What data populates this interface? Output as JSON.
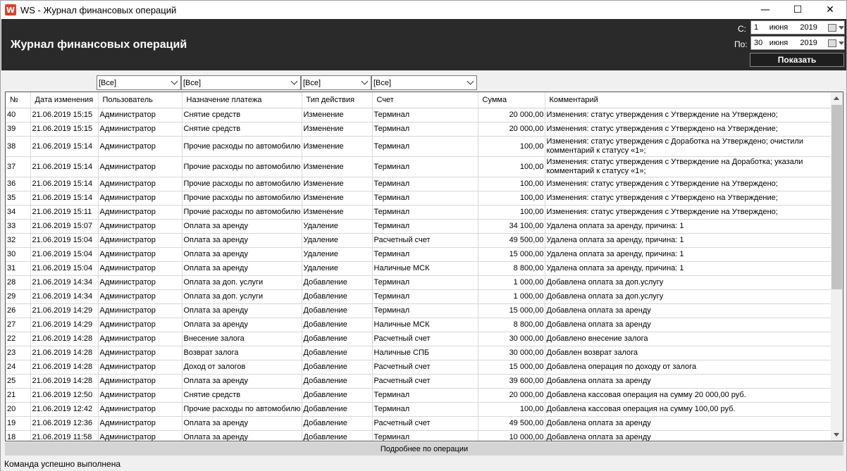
{
  "window": {
    "title": "WS - Журнал финансовых операций",
    "app_icon_letter": "W",
    "minimize": "—",
    "maximize": "☐",
    "close": "✕"
  },
  "header": {
    "title": "Журнал финансовых операций",
    "from_label": "С:",
    "to_label": "По:",
    "from_date": {
      "day": "1",
      "month": "июня",
      "year": "2019"
    },
    "to_date": {
      "day": "30",
      "month": "июня",
      "year": "2019"
    },
    "show_button": "Показать"
  },
  "filters": {
    "user": "[Все]",
    "purpose": "[Все]",
    "action": "[Все]",
    "account": "[Все]"
  },
  "table": {
    "columns": [
      "№",
      "Дата изменения",
      "Пользователь",
      "Назначение платежа",
      "Тип действия",
      "Счет",
      "Сумма",
      "Комментарий"
    ],
    "rows": [
      [
        "40",
        "21.06.2019 15:15",
        "Администратор",
        "Снятие средств",
        "Изменение",
        "Терминал",
        "20 000,00",
        "Изменения: статус утверждения с Утверждение на Утверждено;"
      ],
      [
        "39",
        "21.06.2019 15:15",
        "Администратор",
        "Снятие средств",
        "Изменение",
        "Терминал",
        "20 000,00",
        "Изменения: статус утверждения с Утверждено на Утверждение;"
      ],
      [
        "38",
        "21.06.2019 15:14",
        "Администратор",
        "Прочие расходы по автомобилю",
        "Изменение",
        "Терминал",
        "100,00",
        "Изменения: статус утверждения с Доработка на Утверждено; очистили комментарий к статусу «1»;"
      ],
      [
        "37",
        "21.06.2019 15:14",
        "Администратор",
        "Прочие расходы по автомобилю",
        "Изменение",
        "Терминал",
        "100,00",
        "Изменения: статус утверждения с Утверждение на Доработка; указали комментарий к статусу «1»;"
      ],
      [
        "36",
        "21.06.2019 15:14",
        "Администратор",
        "Прочие расходы по автомобилю",
        "Изменение",
        "Терминал",
        "100,00",
        "Изменения: статус утверждения с Утверждение на Утверждено;"
      ],
      [
        "35",
        "21.06.2019 15:14",
        "Администратор",
        "Прочие расходы по автомобилю",
        "Изменение",
        "Терминал",
        "100,00",
        "Изменения: статус утверждения с Утверждено на Утверждение;"
      ],
      [
        "34",
        "21.06.2019 15:11",
        "Администратор",
        "Прочие расходы по автомобилю",
        "Изменение",
        "Терминал",
        "100,00",
        "Изменения: статус утверждения с Утверждение на Утверждено;"
      ],
      [
        "33",
        "21.06.2019 15:07",
        "Администратор",
        "Оплата за аренду",
        "Удаление",
        "Терминал",
        "34 100,00",
        "Удалена оплата за аренду, причина: 1"
      ],
      [
        "32",
        "21.06.2019 15:04",
        "Администратор",
        "Оплата за аренду",
        "Удаление",
        "Расчетный счет",
        "49 500,00",
        "Удалена оплата за аренду, причина: 1"
      ],
      [
        "30",
        "21.06.2019 15:04",
        "Администратор",
        "Оплата за аренду",
        "Удаление",
        "Терминал",
        "15 000,00",
        "Удалена оплата за аренду, причина: 1"
      ],
      [
        "31",
        "21.06.2019 15:04",
        "Администратор",
        "Оплата за аренду",
        "Удаление",
        "Наличные МСК",
        "8 800,00",
        "Удалена оплата за аренду, причина: 1"
      ],
      [
        "28",
        "21.06.2019 14:34",
        "Администратор",
        "Оплата за доп. услуги",
        "Добавление",
        "Терминал",
        "1 000,00",
        "Добавлена оплата за доп.услугу"
      ],
      [
        "29",
        "21.06.2019 14:34",
        "Администратор",
        "Оплата за доп. услуги",
        "Добавление",
        "Терминал",
        "1 000,00",
        "Добавлена оплата за доп.услугу"
      ],
      [
        "26",
        "21.06.2019 14:29",
        "Администратор",
        "Оплата за аренду",
        "Добавление",
        "Терминал",
        "15 000,00",
        "Добавлена оплата за аренду"
      ],
      [
        "27",
        "21.06.2019 14:29",
        "Администратор",
        "Оплата за аренду",
        "Добавление",
        "Наличные МСК",
        "8 800,00",
        "Добавлена оплата за аренду"
      ],
      [
        "22",
        "21.06.2019 14:28",
        "Администратор",
        "Внесение залога",
        "Добавление",
        "Расчетный счет",
        "30 000,00",
        "Добавлено внесение залога"
      ],
      [
        "23",
        "21.06.2019 14:28",
        "Администратор",
        "Возврат залога",
        "Добавление",
        "Наличные СПБ",
        "30 000,00",
        "Добавлен возврат залога"
      ],
      [
        "24",
        "21.06.2019 14:28",
        "Администратор",
        "Доход от залогов",
        "Добавление",
        "Расчетный счет",
        "15 000,00",
        "Добавлена операция по доходу от залога"
      ],
      [
        "25",
        "21.06.2019 14:28",
        "Администратор",
        "Оплата за аренду",
        "Добавление",
        "Расчетный счет",
        "39 600,00",
        "Добавлена оплата за аренду"
      ],
      [
        "21",
        "21.06.2019 12:50",
        "Администратор",
        "Снятие средств",
        "Добавление",
        "Терминал",
        "20 000,00",
        "Добавлена кассовая операция на сумму 20 000,00 руб."
      ],
      [
        "20",
        "21.06.2019 12:42",
        "Администратор",
        "Прочие расходы по автомобилю",
        "Добавление",
        "Терминал",
        "100,00",
        "Добавлена кассовая операция на сумму 100,00 руб."
      ],
      [
        "19",
        "21.06.2019 12:36",
        "Администратор",
        "Оплата за аренду",
        "Добавление",
        "Расчетный счет",
        "49 500,00",
        "Добавлена оплата за аренду"
      ],
      [
        "18",
        "21.06.2019 11:58",
        "Администратор",
        "Оплата за аренду",
        "Добавление",
        "Терминал",
        "10 000,00",
        "Добавлена оплата за аренду"
      ]
    ]
  },
  "details_button": "Подробнее по операции",
  "status": "Команда успешно выполнена"
}
